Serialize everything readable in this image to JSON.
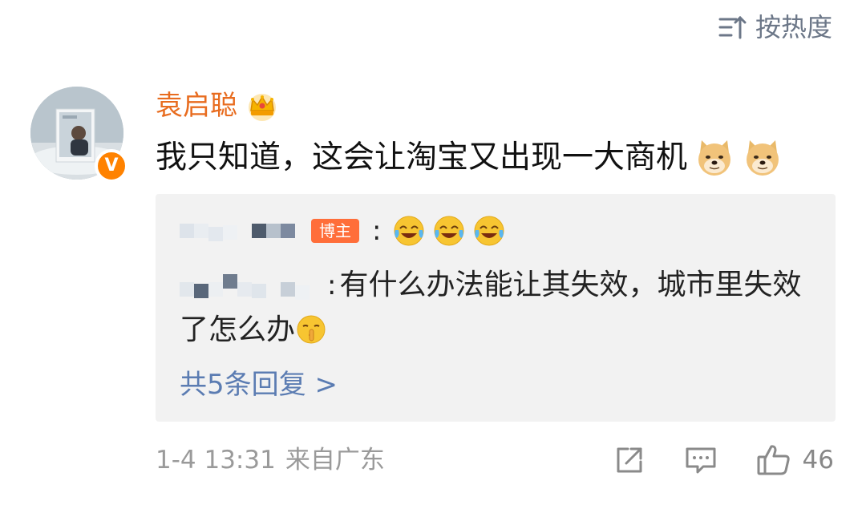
{
  "sort": {
    "label": "按热度",
    "icon": "sort-icon"
  },
  "comment": {
    "username": "袁启聪",
    "user_badge": "crown-icon",
    "verified_mark": "V",
    "text": "我只知道，这会让淘宝又出现一大商机",
    "trailing_emojis": [
      "doge-icon",
      "doge-icon"
    ],
    "reply_box": {
      "first_reply": {
        "author_tag": "博主",
        "colon": ":",
        "emojis": [
          "laugh-cry-icon",
          "laugh-cry-icon",
          "laugh-cry-icon"
        ]
      },
      "second_reply": {
        "colon": ":",
        "text": "有什么办法能让其失效，城市里失效了怎么办",
        "emoji": "shush-icon"
      },
      "more_link": "共5条回复 >"
    },
    "time": "1-4 13:31",
    "source": "来自广东",
    "actions": {
      "share": "share-icon",
      "reply": "comment-icon",
      "like": "like-icon",
      "like_count": "46"
    }
  },
  "colors": {
    "username": "#e86c1f",
    "link": "#5b7cb2",
    "badge": "#ff6e3a",
    "verified": "#ff8200",
    "meta": "#9a9a9a"
  }
}
